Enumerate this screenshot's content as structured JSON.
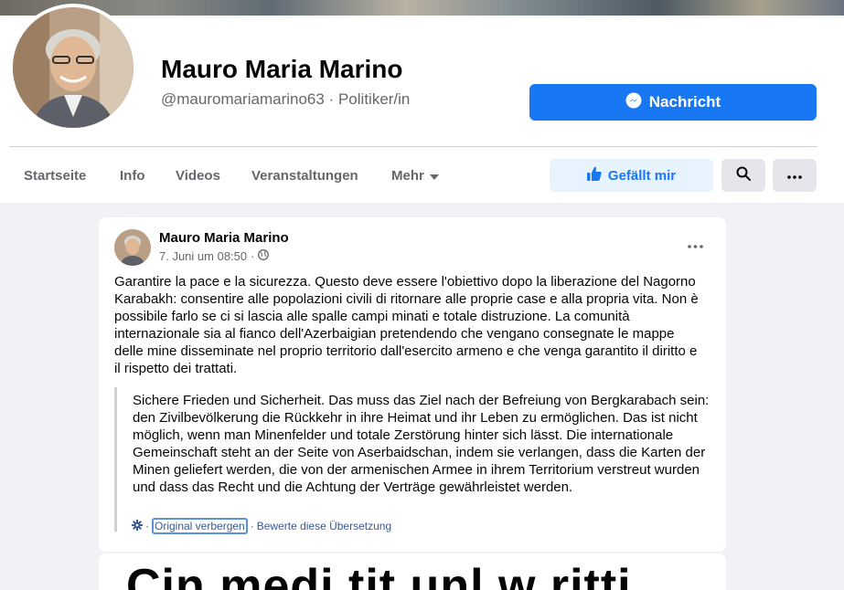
{
  "profile": {
    "name": "Mauro Maria Marino",
    "handle": "@mauromariamarino63",
    "separator": "·",
    "category": "Politiker/in"
  },
  "actions": {
    "message_label": "Nachricht",
    "like_label": "Gefällt mir"
  },
  "nav": {
    "items": [
      "Startseite",
      "Info",
      "Videos",
      "Veranstaltungen",
      "Mehr"
    ]
  },
  "post": {
    "author": "Mauro Maria Marino",
    "date": "7. Juni um 08:50",
    "separator": "·",
    "text": "Garantire la pace e la sicurezza. Questo deve essere l'obiettivo  dopo la liberazione del Nagorno Karabakh: consentire alle popolazioni civili di ritornare alle proprie case e alla propria vita. Non è possibile farlo se ci si lascia alle spalle campi minati e totale distruzione. La comunità internazionale sia al fianco dell'Azerbaigian pretendendo che vengano consegnate le mappe delle mine disseminate nel proprio territorio dall'esercito armeno e che venga garantito il diritto e il rispetto dei trattati.",
    "translation": "Sichere Frieden und Sicherheit. Das muss das Ziel nach der Befreiung von Bergkarabach sein: den Zivilbevölkerung die Rückkehr in ihre Heimat und ihr Leben zu ermöglichen. Das ist nicht möglich, wenn man Minenfelder und totale Zerstörung hinter sich lässt. Die internationale Gemeinschaft steht an der Seite von Aserbaidschan, indem sie verlangen, dass die Karten der Minen geliefert werden, die von der armenischen Armee in ihrem Territorium verstreut wurden und dass das Recht und die Achtung der Verträge gewährleistet werden.",
    "hide_original": "Original verbergen",
    "rate_translation": "Bewerte diese Übersetzung",
    "link_separator": "·"
  },
  "next_post": {
    "partial_text": "Cin medi tit unl w ritti"
  },
  "colors": {
    "accent": "#1877f2",
    "background": "#f0f2f5",
    "secondary_text": "#65676b",
    "link": "#385898"
  }
}
